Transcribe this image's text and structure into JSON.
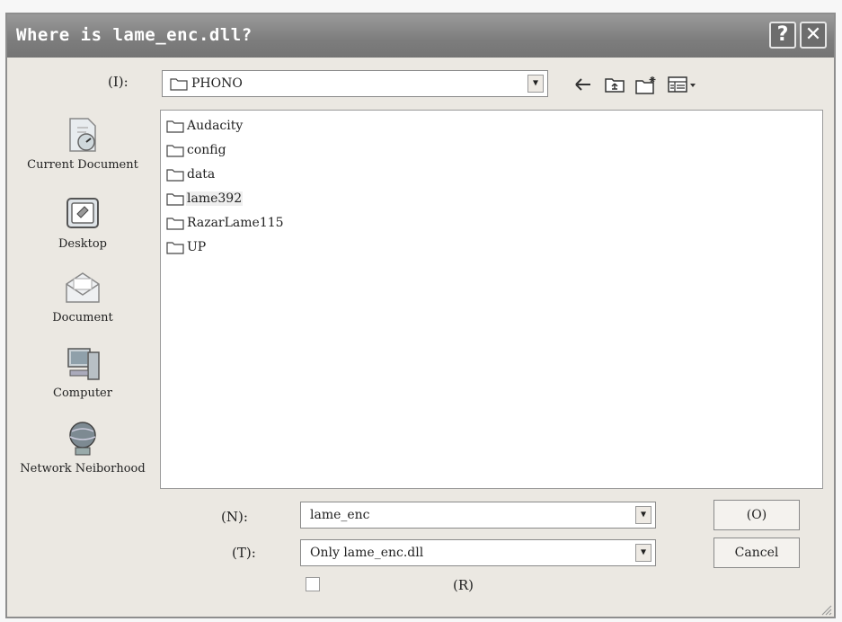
{
  "dialog": {
    "title": "Where is lame_enc.dll?",
    "help_label": "?",
    "close_label": "✕"
  },
  "look_in": {
    "label": "(I):",
    "value": "PHONO"
  },
  "toolbar": {
    "back_icon": "back-arrow-icon",
    "up_icon": "up-folder-icon",
    "new_folder_icon": "new-folder-icon",
    "view_menu_icon": "view-menu-icon"
  },
  "places": [
    {
      "label": "Current Document",
      "icon": "recent-documents-icon"
    },
    {
      "label": "Desktop",
      "icon": "desktop-icon"
    },
    {
      "label": "Document",
      "icon": "my-documents-icon"
    },
    {
      "label": "Computer",
      "icon": "my-computer-icon"
    },
    {
      "label": "Network Neiborhood",
      "icon": "network-icon"
    }
  ],
  "files": [
    {
      "name": "Audacity"
    },
    {
      "name": "config"
    },
    {
      "name": "data"
    },
    {
      "name": "lame392"
    },
    {
      "name": "RazarLame115"
    },
    {
      "name": "UP"
    }
  ],
  "filename": {
    "label": "(N):",
    "value": "lame_enc"
  },
  "filetype": {
    "label": "(T):",
    "value": "Only lame_enc.dll"
  },
  "readonly": {
    "label": "(R)"
  },
  "buttons": {
    "open_label": "(O)",
    "cancel_label": "Cancel"
  }
}
